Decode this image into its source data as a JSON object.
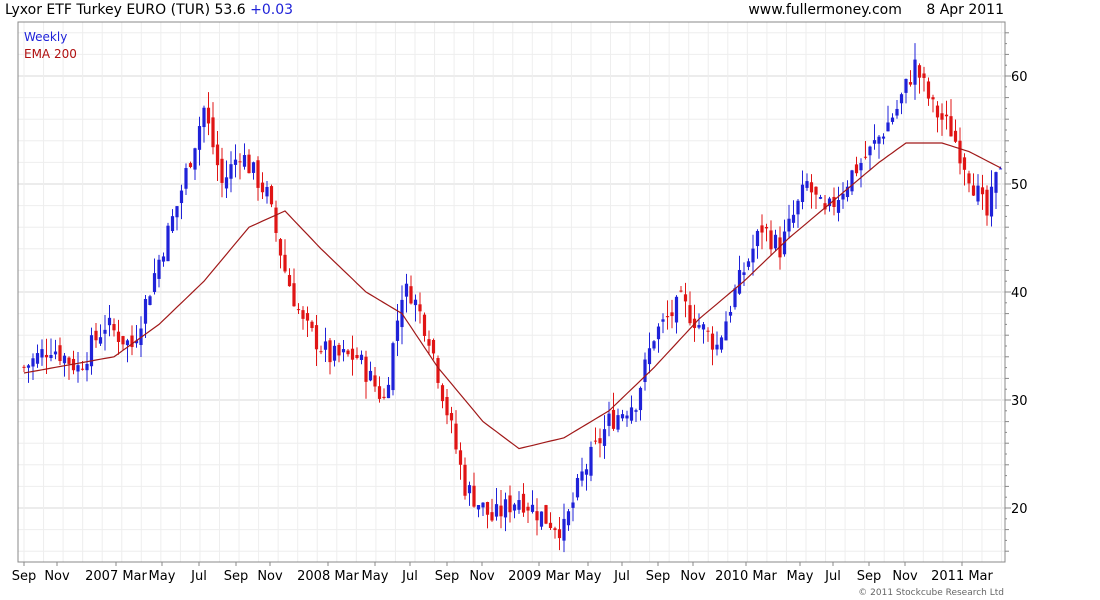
{
  "header": {
    "title": "Lyxor ETF Turkey EURO (TUR) 53.6",
    "change": "+0.03",
    "site": "www.fullermoney.com",
    "date": "8 Apr 2011"
  },
  "footer": {
    "copyright": "© 2011 Stockcube Research Ltd"
  },
  "colors": {
    "up": "#1f22d8",
    "down": "#e01515",
    "ema": "#a01818",
    "grid": "#d8d8d8",
    "minor_grid": "#eeeeee"
  },
  "chart_data": {
    "type": "candlestick",
    "title": "Lyxor ETF Turkey EURO (TUR) 53.6 +0.03",
    "legend": [
      "Weekly",
      "EMA 200"
    ],
    "legend_position": "top-left",
    "y_axis_side": "right",
    "ylim": [
      15,
      65
    ],
    "yticks": [
      20,
      30,
      40,
      50,
      60
    ],
    "x_tick_labels": [
      "Sep",
      "Nov",
      "2007 Mar",
      "May",
      "Jul",
      "Sep",
      "Nov",
      "2008 Mar",
      "May",
      "Jul",
      "Sep",
      "Nov",
      "2009 Mar",
      "May",
      "Jul",
      "Sep",
      "Nov",
      "2010 Mar",
      "May",
      "Jul",
      "Sep",
      "Nov",
      "2011 Mar"
    ],
    "grid": true,
    "close_anchors": [
      [
        0,
        33
      ],
      [
        6,
        35
      ],
      [
        12,
        33
      ],
      [
        18,
        37
      ],
      [
        24,
        35
      ],
      [
        30,
        43
      ],
      [
        34,
        48
      ],
      [
        40,
        57
      ],
      [
        44,
        50
      ],
      [
        48,
        53
      ],
      [
        54,
        49
      ],
      [
        58,
        42
      ],
      [
        62,
        37
      ],
      [
        68,
        34
      ],
      [
        74,
        34
      ],
      [
        80,
        30
      ],
      [
        84,
        40
      ],
      [
        86,
        40
      ],
      [
        90,
        36
      ],
      [
        94,
        29
      ],
      [
        98,
        22
      ],
      [
        104,
        19
      ],
      [
        110,
        21
      ],
      [
        116,
        19
      ],
      [
        120,
        18
      ],
      [
        124,
        23
      ],
      [
        130,
        28
      ],
      [
        136,
        30
      ],
      [
        140,
        36
      ],
      [
        146,
        39
      ],
      [
        150,
        37
      ],
      [
        154,
        35
      ],
      [
        158,
        40
      ],
      [
        164,
        46
      ],
      [
        168,
        44
      ],
      [
        174,
        50
      ],
      [
        178,
        47
      ],
      [
        184,
        51
      ],
      [
        188,
        53
      ],
      [
        194,
        57
      ],
      [
        198,
        61
      ],
      [
        202,
        57
      ],
      [
        206,
        55
      ],
      [
        210,
        51
      ],
      [
        214,
        47
      ],
      [
        217,
        52
      ]
    ],
    "ema_anchors": [
      [
        0,
        32.5
      ],
      [
        20,
        34
      ],
      [
        30,
        37
      ],
      [
        40,
        41
      ],
      [
        50,
        46
      ],
      [
        58,
        47.5
      ],
      [
        66,
        44
      ],
      [
        76,
        40
      ],
      [
        84,
        38
      ],
      [
        92,
        33
      ],
      [
        102,
        28
      ],
      [
        110,
        25.5
      ],
      [
        120,
        26.5
      ],
      [
        130,
        29
      ],
      [
        140,
        33
      ],
      [
        150,
        37.5
      ],
      [
        160,
        41
      ],
      [
        170,
        45
      ],
      [
        180,
        48.5
      ],
      [
        190,
        52
      ],
      [
        196,
        53.8
      ],
      [
        204,
        53.8
      ],
      [
        210,
        53
      ],
      [
        217,
        51.5
      ]
    ]
  }
}
